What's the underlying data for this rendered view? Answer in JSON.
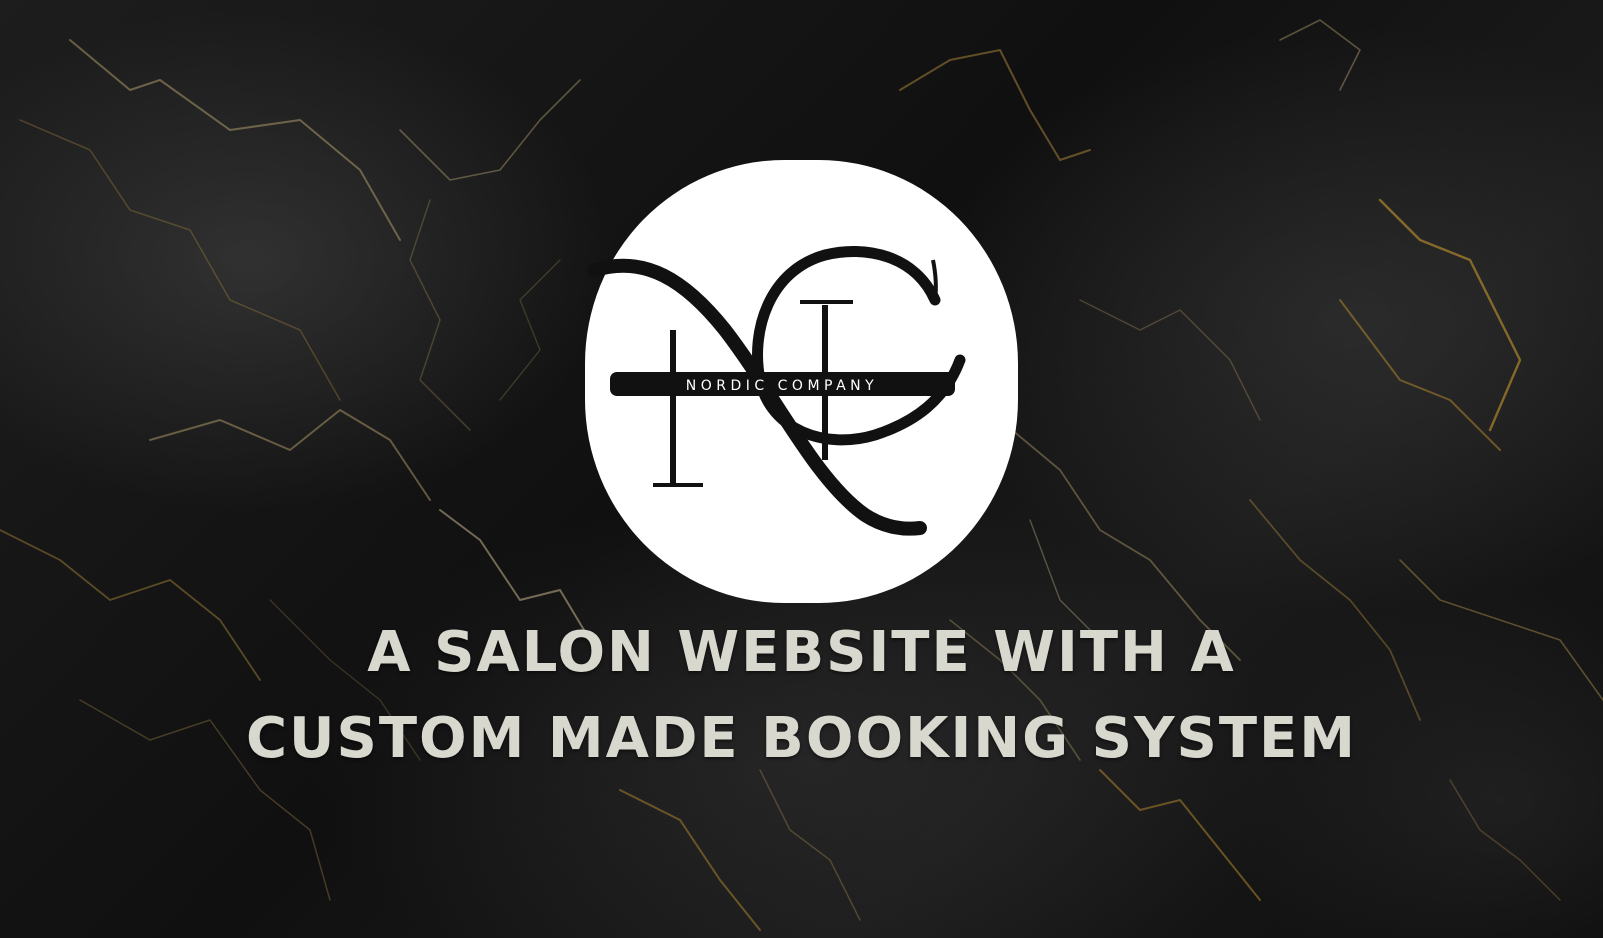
{
  "logo": {
    "letters": "NC",
    "band_text": "NORDIC COMPANY"
  },
  "headline": {
    "line1": "A SALON WEBSITE WITH A",
    "line2": "CUSTOM MADE BOOKING SYSTEM"
  },
  "colors": {
    "background": "#141414",
    "vein": "#b8913f",
    "headline": "#d8d8cf",
    "badge": "#ffffff",
    "logo_ink": "#111111"
  }
}
